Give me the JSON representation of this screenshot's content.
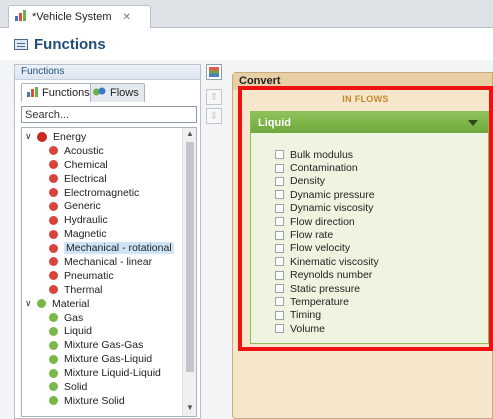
{
  "editor_tab": {
    "title": "*Vehicle System",
    "close_glyph": "✕"
  },
  "page": {
    "title": "Functions"
  },
  "left_panel": {
    "caption": "Functions",
    "tabs": [
      {
        "label": "Functions"
      },
      {
        "label": "Flows"
      }
    ],
    "search": {
      "placeholder": "Search...",
      "value": ""
    },
    "tree": [
      {
        "label": "Energy",
        "expanded": true,
        "children": [
          "Acoustic",
          "Chemical",
          "Electrical",
          "Electromagnetic",
          "Generic",
          "Hydraulic",
          "Magnetic",
          "Mechanical - rotational",
          "Mechanical - linear",
          "Pneumatic",
          "Thermal"
        ],
        "selected": "Mechanical - rotational"
      },
      {
        "label": "Material",
        "expanded": true,
        "children": [
          "Gas",
          "Liquid",
          "Mixture Gas-Gas",
          "Mixture Gas-Liquid",
          "Mixture Liquid-Liquid",
          "Solid",
          "Mixture Solid"
        ]
      }
    ]
  },
  "right_panel": {
    "title": "Convert",
    "section_label": "IN FLOWS",
    "flow_group": {
      "name": "Liquid",
      "properties": [
        "Bulk modulus",
        "Contamination",
        "Density",
        "Dynamic pressure",
        "Dynamic viscosity",
        "Flow direction",
        "Flow rate",
        "Flow velocity",
        "Kinematic viscosity",
        "Reynolds number",
        "Static pressure",
        "Temperature",
        "Timing",
        "Volume"
      ]
    }
  },
  "colors": {
    "energy": "#c8281e",
    "energy_item": "#d9433b",
    "material": "#7ab648",
    "highlight_border": "#ee1111",
    "liquid_header": "#7ab648",
    "convert_bg": "#f5e6cc"
  }
}
